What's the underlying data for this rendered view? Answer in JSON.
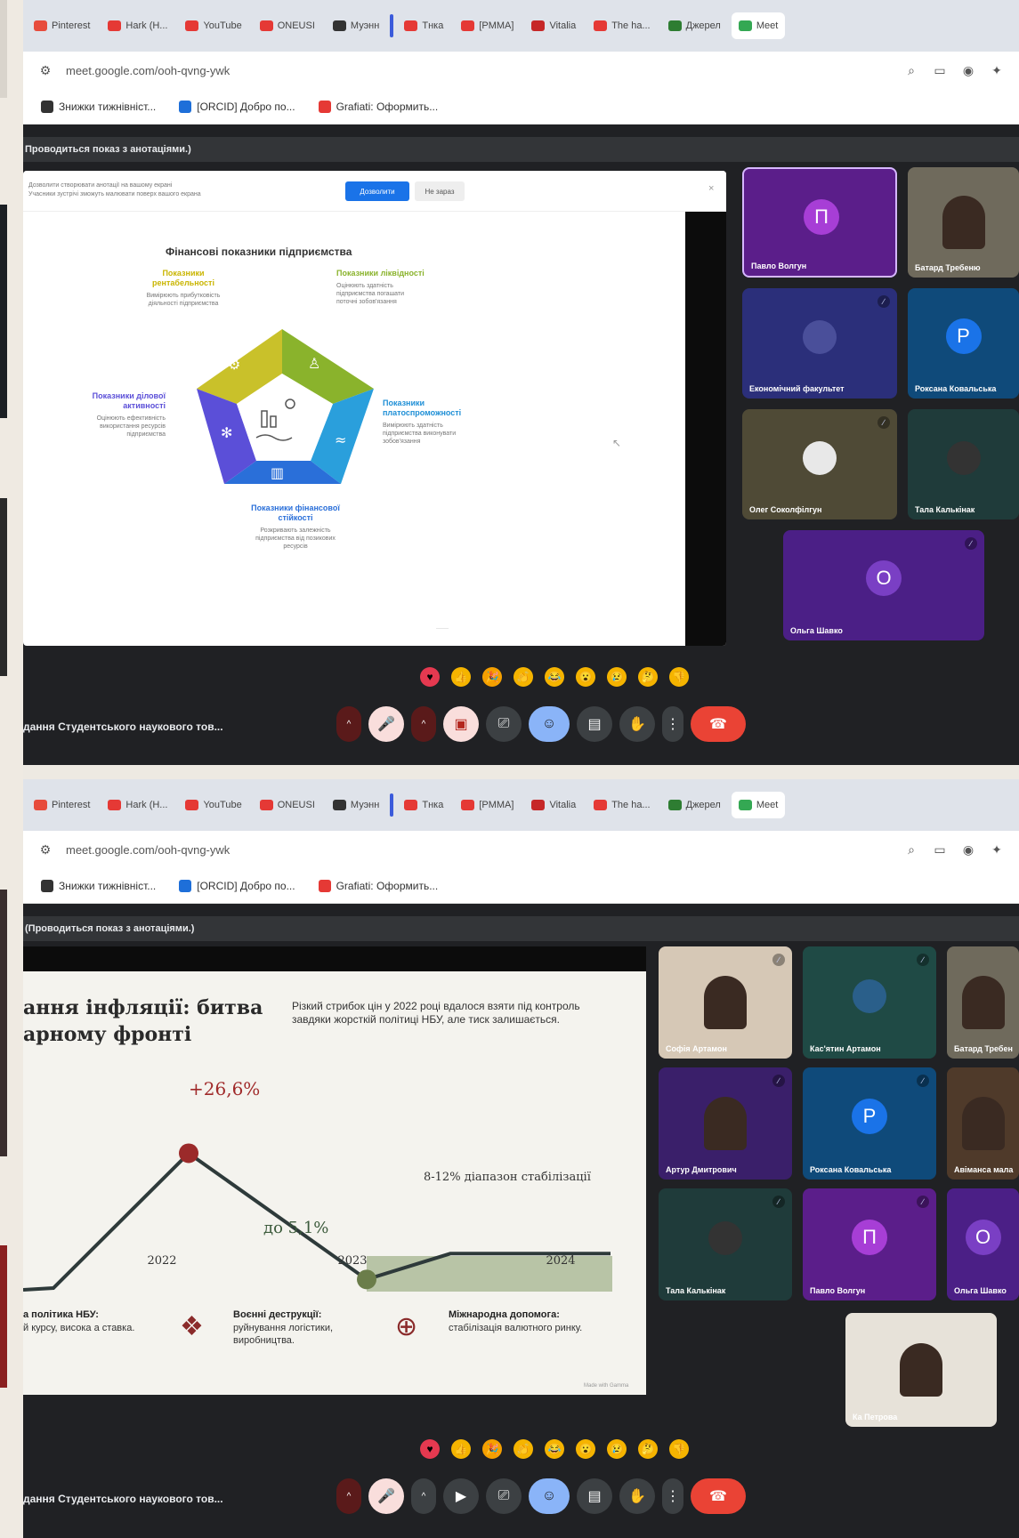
{
  "tabs": [
    {
      "label": "Pinterest",
      "color": "#e74c3c"
    },
    {
      "label": "Hark (H...",
      "color": "#e53935"
    },
    {
      "label": "YouTube",
      "color": "#e53935"
    },
    {
      "label": "ONEUSI",
      "color": "#e53935"
    },
    {
      "label": "Муэнн",
      "color": "#333"
    },
    {
      "label": "Тнка",
      "color": "#e53935"
    },
    {
      "label": "[PMMA]",
      "color": "#e53935"
    },
    {
      "label": "Vitalia",
      "color": "#c62828"
    },
    {
      "label": "The ha...",
      "color": "#e53935"
    },
    {
      "label": "Джерел",
      "color": "#2e7d32"
    },
    {
      "label": "Meet",
      "color": "#34a853"
    }
  ],
  "address": {
    "url": "meet.google.com/ooh-qvng-ywk"
  },
  "bookmarks": [
    {
      "label": "Знижки тижнівніст...",
      "color": "#333"
    },
    {
      "label": "[ORCID] Добро по...",
      "color": "#1e6fd9"
    },
    {
      "label": "Grafiati: Оформить...",
      "color": "#e53935"
    }
  ],
  "presentation_banner_1": "Проводиться показ з анотаціями.)",
  "presentation_banner_2": "(Проводиться показ з анотаціями.)",
  "slide1": {
    "prompt_text": "Дозволити створювати анотації на вашому екрані",
    "prompt_sub": "Учасники зустрічі зможуть малювати поверх вашого екрана",
    "allow_button": "Дозволити",
    "not_now_button": "Не зараз",
    "title": "Фінансові показники підприємства",
    "labels": [
      {
        "head": "Показники рентабельності",
        "body": "Вимірюють прибутковість діяльності підприємства",
        "color": "#c9b500"
      },
      {
        "head": "Показники ліквідності",
        "body": "Оцінюють здатність підприємства погашати поточні зобов'язання",
        "color": "#8ab32c"
      },
      {
        "head": "Показники платоспроможності",
        "body": "Вимірюють здатність підприємства виконувати зобов'язання",
        "color": "#1e8fd6"
      },
      {
        "head": "Показники фінансової стійкості",
        "body": "Розкривають залежність підприємства від позикових ресурсів",
        "color": "#2a6fd9"
      },
      {
        "head": "Показники ділової активності",
        "body": "Оцінюють ефективність використання ресурсів підприємства",
        "color": "#5b4fd8"
      }
    ]
  },
  "slide2": {
    "title_line1": "ання інфляції: битва",
    "title_line2": "арному фронті",
    "intro": "Різкий стрибок цін у 2022 році вдалося взяти під контроль завдяки жорсткій політиці НБУ, але тиск залишається.",
    "peak_label": "+26,6%",
    "low_label": "до 5,1%",
    "band_label": "8-12% діапазон стабілізації",
    "footer_items": [
      {
        "head": "а політика НБУ:",
        "body": "й курсу, висока а ставка."
      },
      {
        "head": "Воєнні деструкції:",
        "body": "руйнування логістики, виробництва."
      },
      {
        "head": "Міжнародна допомога:",
        "body": "стабілізація валютного ринку."
      }
    ],
    "watermark": "Made with Gamma"
  },
  "chart_data": {
    "type": "line",
    "x": [
      "2022",
      "2023",
      "2024"
    ],
    "series": [
      {
        "values": [
          null,
          26.6,
          5.1,
          9.5
        ]
      }
    ],
    "x_ticks": [
      "2022",
      "2023",
      "2024"
    ],
    "annotations": [
      "+26,6%",
      "до 5,1%",
      "8-12% діапазон стабілізації"
    ],
    "band": [
      8,
      12
    ]
  },
  "participants_1": [
    {
      "name": "Павло Волгун",
      "initial": "П",
      "bg": "#5b1e8a",
      "av": "#a73ed6"
    },
    {
      "name": "Батард Требеню",
      "initial": "",
      "bg": "#6f6a5c",
      "av": ""
    },
    {
      "name": "Економічний факультет",
      "initial": "",
      "bg": "#2b2f7a",
      "av": "#4a4f9a"
    },
    {
      "name": "Роксана Ковальська",
      "initial": "P",
      "bg": "#0f4a7a",
      "av": "#1a73e8"
    },
    {
      "name": "Олег Соколфілгун",
      "initial": "",
      "bg": "#4f4a36",
      "av": "#e8e8e8"
    },
    {
      "name": "Тала Калькінак",
      "initial": "",
      "bg": "#1f3b3a",
      "av": "#333"
    },
    {
      "name": "Ольга Шавко",
      "initial": "O",
      "bg": "#4b1f86",
      "av": "#7a3fc4"
    }
  ],
  "participants_2": [
    {
      "name": "Софія Артамон",
      "initial": "",
      "bg": "#d6c8b6",
      "av": ""
    },
    {
      "name": "Кас'ятин Артамон",
      "initial": "",
      "bg": "#1f4a45",
      "av": "#2a5f8a"
    },
    {
      "name": "Батард Требен",
      "initial": "",
      "bg": "#6f6a5c",
      "av": ""
    },
    {
      "name": "Артур Дмитрович",
      "initial": "",
      "bg": "#3a1f6a",
      "av": ""
    },
    {
      "name": "Роксана Ковальська",
      "initial": "P",
      "bg": "#0f4a7a",
      "av": "#1a73e8"
    },
    {
      "name": "Авіманса мала",
      "initial": "",
      "bg": "#4f3a2a",
      "av": ""
    },
    {
      "name": "Тала Калькінак",
      "initial": "",
      "bg": "#1f3b3a",
      "av": "#333"
    },
    {
      "name": "Павло Волгун",
      "initial": "П",
      "bg": "#5b1e8a",
      "av": "#a73ed6"
    },
    {
      "name": "Ольга Шавко",
      "initial": "O",
      "bg": "#4b1f86",
      "av": "#7a3fc4"
    },
    {
      "name": "Ка Петрова",
      "initial": "",
      "bg": "#e7e2d9",
      "av": ""
    }
  ],
  "meeting_name": "дання Студентського наукового тов...",
  "reactions": [
    {
      "glyph": "♥",
      "bg": "#e53950"
    },
    {
      "glyph": "👍",
      "bg": "#f5b400"
    },
    {
      "glyph": "🎉",
      "bg": "#f5a000"
    },
    {
      "glyph": "👏",
      "bg": "#f5b400"
    },
    {
      "glyph": "😂",
      "bg": "#f5b400"
    },
    {
      "glyph": "😮",
      "bg": "#f5b400"
    },
    {
      "glyph": "😢",
      "bg": "#f5b400"
    },
    {
      "glyph": "🤔",
      "bg": "#f5b400"
    },
    {
      "glyph": "👎",
      "bg": "#f5b400"
    }
  ]
}
